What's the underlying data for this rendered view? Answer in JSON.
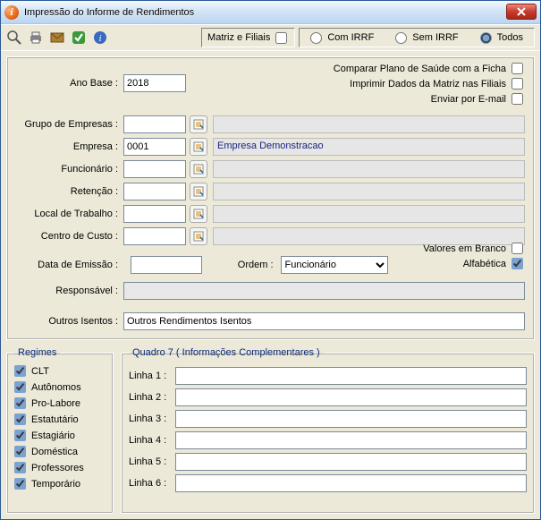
{
  "window": {
    "title": "Impressão do Informe de Rendimentos"
  },
  "toolbar": {
    "matriz_filiais": "Matriz e Filiais",
    "com_irrf": "Com IRRF",
    "sem_irrf": "Sem IRRF",
    "todos": "Todos"
  },
  "right_checks": {
    "comparar": "Comparar Plano de Saúde com a Ficha",
    "imprimir_matriz": "Imprimir Dados da Matriz nas Filiais",
    "enviar_email": "Enviar por E-mail"
  },
  "fields": {
    "ano_base_label": "Ano Base :",
    "ano_base_value": "2018",
    "grupo_label": "Grupo de Empresas :",
    "grupo_value": "",
    "grupo_display": "",
    "empresa_label": "Empresa :",
    "empresa_value": "0001",
    "empresa_display": "Empresa Demonstracao",
    "funcionario_label": "Funcionário :",
    "funcionario_value": "",
    "funcionario_display": "",
    "retencao_label": "Retenção :",
    "retencao_value": "",
    "retencao_display": "",
    "local_label": "Local de Trabalho :",
    "local_value": "",
    "local_display": "",
    "centro_label": "Centro de Custo :",
    "centro_value": "",
    "centro_display": "",
    "data_emissao_label": "Data de Emissão :",
    "data_emissao_value": "",
    "ordem_label": "Ordem :",
    "ordem_selected": "Funcionário",
    "valores_branco": "Valores em Branco",
    "alfabetica": "Alfabética",
    "responsavel_label": "Responsável :",
    "responsavel_value": "",
    "outros_isentos_label": "Outros Isentos :",
    "outros_isentos_value": "Outros Rendimentos Isentos"
  },
  "regimes": {
    "legend": "Regimes",
    "items": [
      {
        "label": "CLT",
        "checked": true
      },
      {
        "label": "Autônomos",
        "checked": true
      },
      {
        "label": "Pro-Labore",
        "checked": true
      },
      {
        "label": "Estatutário",
        "checked": true
      },
      {
        "label": "Estagiário",
        "checked": true
      },
      {
        "label": "Doméstica",
        "checked": true
      },
      {
        "label": "Professores",
        "checked": true
      },
      {
        "label": "Temporário",
        "checked": true
      }
    ]
  },
  "quadro7": {
    "legend": "Quadro 7 ( Informações Complementares )",
    "lines": [
      {
        "label": "Linha 1 :",
        "value": ""
      },
      {
        "label": "Linha 2 :",
        "value": ""
      },
      {
        "label": "Linha 3 :",
        "value": ""
      },
      {
        "label": "Linha 4 :",
        "value": ""
      },
      {
        "label": "Linha 5 :",
        "value": ""
      },
      {
        "label": "Linha 6 :",
        "value": ""
      }
    ]
  }
}
